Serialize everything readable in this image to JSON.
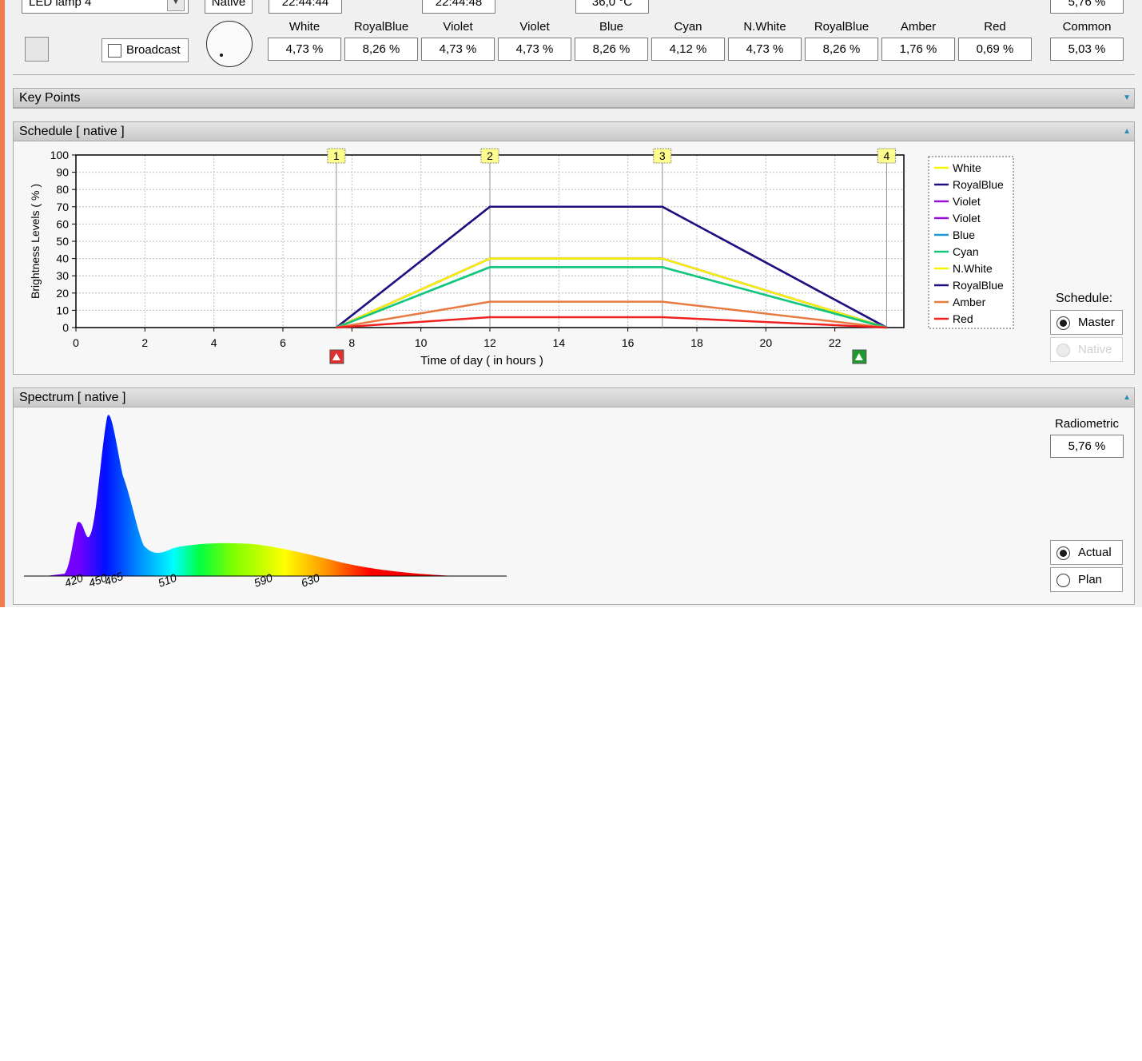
{
  "top": {
    "lamp_select": "LED lamp 4",
    "mode_label": "Native",
    "time1": "22:44:44",
    "time2": "22:44:48",
    "temperature": "36,0 °C",
    "top_percent": "5,76 %",
    "broadcast_label": "Broadcast",
    "channels": [
      {
        "name": "White",
        "value": "4,73 %"
      },
      {
        "name": "RoyalBlue",
        "value": "8,26 %"
      },
      {
        "name": "Violet",
        "value": "4,73 %"
      },
      {
        "name": "Violet",
        "value": "4,73 %"
      },
      {
        "name": "Blue",
        "value": "8,26 %"
      },
      {
        "name": "Cyan",
        "value": "4,12 %"
      },
      {
        "name": "N.White",
        "value": "4,73 %"
      },
      {
        "name": "RoyalBlue",
        "value": "8,26 %"
      },
      {
        "name": "Amber",
        "value": "1,76 %"
      },
      {
        "name": "Red",
        "value": "0,69 %"
      }
    ],
    "common": {
      "name": "Common",
      "value": "5,03 %"
    }
  },
  "keypoints": {
    "title": "Key Points"
  },
  "schedule": {
    "title": "Schedule  [ native ]",
    "schedule_label": "Schedule:",
    "options": [
      "Master",
      "Native"
    ],
    "selected": "Master"
  },
  "spectrum": {
    "title": "Spectrum  [ native ]",
    "radiometric_label": "Radiometric",
    "radiometric_value": "5,76 %",
    "options": [
      "Actual",
      "Plan"
    ],
    "selected": "Actual",
    "wavelength_ticks": [
      "420",
      "450",
      "465",
      "510",
      "590",
      "630"
    ]
  },
  "colors": {
    "accent": "#f07c50",
    "White": "#f5f500",
    "RoyalBlue": "#1e1080",
    "Violet": "#9a10d8",
    "Blue": "#1a9ad0",
    "Cyan": "#10c878",
    "N.White": "#f5f500",
    "Amber": "#e87a40",
    "Red": "#f02020"
  },
  "chart_data": {
    "type": "line",
    "xlabel": "Time of day  ( in hours )",
    "ylabel": "Brightness Levels  ( % )",
    "xlim": [
      0,
      24
    ],
    "ylim": [
      0,
      100
    ],
    "x_ticks": [
      0,
      2,
      4,
      6,
      8,
      10,
      12,
      14,
      16,
      18,
      20,
      22
    ],
    "y_ticks": [
      0,
      10,
      20,
      30,
      40,
      50,
      60,
      70,
      80,
      90,
      100
    ],
    "grid": true,
    "legend": "right",
    "key_points": [
      {
        "label": "1",
        "x": 7.55
      },
      {
        "label": "2",
        "x": 12.0
      },
      {
        "label": "3",
        "x": 17.0
      },
      {
        "label": "4",
        "x": 23.5
      }
    ],
    "x": [
      7.55,
      12.0,
      17.0,
      23.5
    ],
    "series": [
      {
        "name": "White",
        "values": [
          0,
          40,
          40,
          0
        ]
      },
      {
        "name": "RoyalBlue",
        "values": [
          0,
          70,
          70,
          0
        ]
      },
      {
        "name": "Violet",
        "values": [
          0,
          40,
          40,
          0
        ]
      },
      {
        "name": "Violet",
        "values": [
          0,
          40,
          40,
          0
        ]
      },
      {
        "name": "Blue",
        "values": [
          0,
          35,
          35,
          0
        ]
      },
      {
        "name": "Cyan",
        "values": [
          0,
          35,
          35,
          0
        ]
      },
      {
        "name": "N.White",
        "values": [
          0,
          40,
          40,
          0
        ]
      },
      {
        "name": "RoyalBlue",
        "values": [
          0,
          70,
          70,
          0
        ]
      },
      {
        "name": "Amber",
        "values": [
          0,
          15,
          15,
          0
        ]
      },
      {
        "name": "Red",
        "values": [
          0,
          6,
          6,
          0
        ]
      }
    ],
    "markers": [
      {
        "name": "sunrise-marker",
        "x": 7.55,
        "color": "#e03030"
      },
      {
        "name": "sunset-marker",
        "x": 22.7,
        "color": "#209a30"
      }
    ]
  }
}
